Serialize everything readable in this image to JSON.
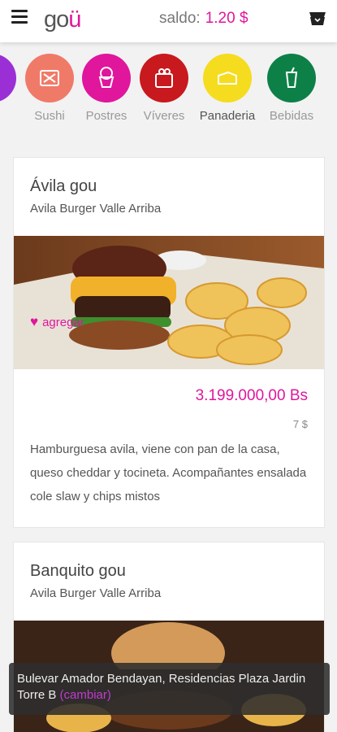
{
  "header": {
    "logo_text": "go",
    "logo_accent": "ü",
    "saldo_label": "saldo:",
    "saldo_amount": "1.20 $",
    "icons": [
      "menu-icon",
      "cart-icon"
    ]
  },
  "categories": [
    {
      "label": "Sushi",
      "color": "#f07a68",
      "icon": "sushi-icon"
    },
    {
      "label": "Postres",
      "color": "#e0169d",
      "icon": "ice-cream-icon"
    },
    {
      "label": "Víveres",
      "color": "#c8191e",
      "icon": "groceries-icon"
    },
    {
      "label": "Panaderia",
      "color": "#f5dc1f",
      "icon": "bread-icon"
    },
    {
      "label": "Bebidas",
      "color": "#0d8048",
      "icon": "drink-icon"
    }
  ],
  "products": [
    {
      "title": "Ávila gou",
      "subtitle": "Avila Burger Valle Arriba",
      "fav_label": "agregar",
      "price_bs": "3.199.000,00 Bs",
      "price_usd": "7 $",
      "description": "Hamburguesa avila, viene con pan de la casa, queso cheddar y tocineta. Acompañantes ensalada cole slaw y chips mistos"
    },
    {
      "title": "Banquito gou",
      "subtitle": "Avila Burger Valle Arriba"
    }
  ],
  "address": {
    "text": "Bulevar Amador Bendayan, Residencias Plaza Jardin Torre B",
    "change_label": "(cambiar)"
  },
  "colors": {
    "accent": "#e0169d"
  }
}
